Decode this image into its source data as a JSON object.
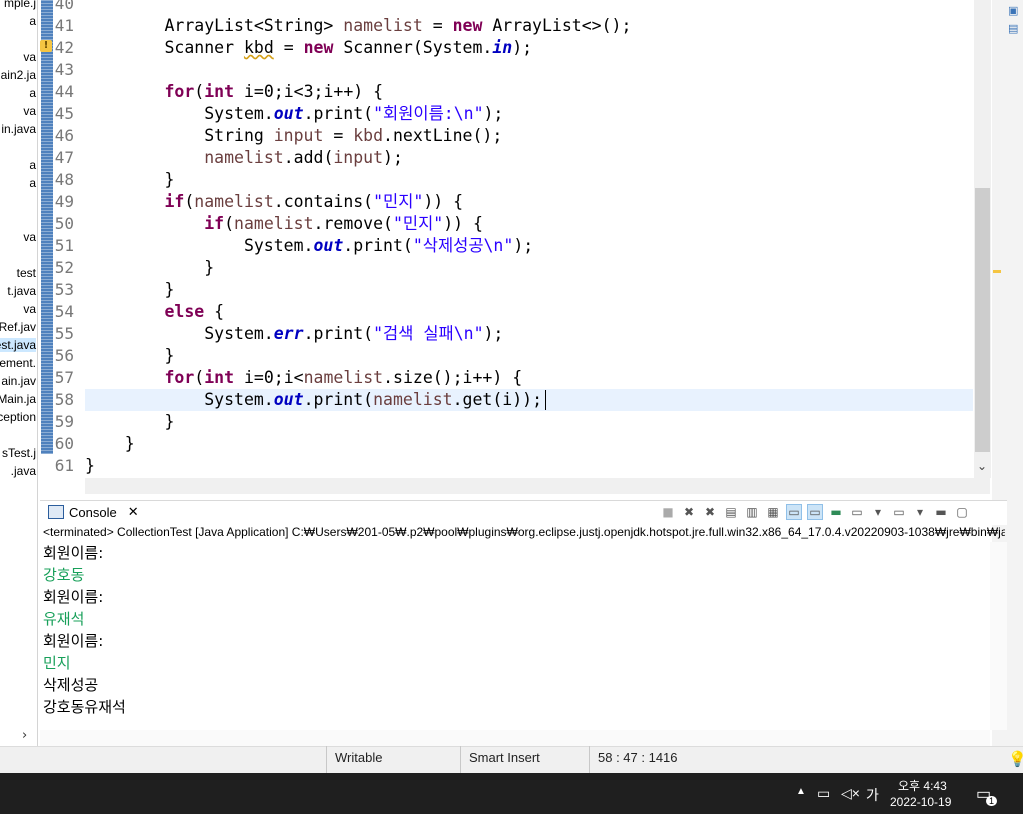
{
  "explorer": {
    "items": [
      "mple.j",
      "a",
      "",
      "va",
      "ain2.ja",
      "a",
      "va",
      "in.java",
      "",
      "a",
      "a",
      "",
      "",
      "va",
      "",
      "test",
      "t.java",
      "va",
      "Ref.jav",
      "est.java",
      "ement.",
      "ain.jav",
      "Main.ja",
      "ception",
      "",
      "sTest.j",
      ".java"
    ]
  },
  "editor": {
    "line_numbers": [
      "40",
      "41",
      "42",
      "43",
      "44",
      "45",
      "46",
      "47",
      "48",
      "49",
      "50",
      "51",
      "52",
      "53",
      "54",
      "55",
      "56",
      "57",
      "58",
      "59",
      "60",
      "61"
    ],
    "lines": [
      [],
      [
        [
          "",
          "        ArrayList<String> "
        ],
        [
          "var",
          "namelist"
        ],
        [
          "",
          " = "
        ],
        [
          "kw",
          "new"
        ],
        [
          "",
          " ArrayList<>();"
        ]
      ],
      [
        [
          "",
          "        Scanner "
        ],
        [
          "warnvar",
          "kbd"
        ],
        [
          "",
          " = "
        ],
        [
          "kw",
          "new"
        ],
        [
          "",
          " Scanner(System."
        ],
        [
          "fld",
          "in"
        ],
        [
          "",
          ");"
        ]
      ],
      [],
      [
        [
          "",
          "        "
        ],
        [
          "kw",
          "for"
        ],
        [
          "",
          "("
        ],
        [
          "kw",
          "int"
        ],
        [
          "",
          " i=0;i<3;i++) {"
        ]
      ],
      [
        [
          "",
          "            System."
        ],
        [
          "fld",
          "out"
        ],
        [
          "",
          ".print("
        ],
        [
          "str",
          "\"회원이름:\\n\""
        ],
        [
          "",
          ");"
        ]
      ],
      [
        [
          "",
          "            String "
        ],
        [
          "var",
          "input"
        ],
        [
          "",
          " = "
        ],
        [
          "var",
          "kbd"
        ],
        [
          "",
          ".nextLine();"
        ]
      ],
      [
        [
          "",
          "            "
        ],
        [
          "var",
          "namelist"
        ],
        [
          "",
          ".add("
        ],
        [
          "var",
          "input"
        ],
        [
          "",
          ");"
        ]
      ],
      [
        [
          "",
          "        }"
        ]
      ],
      [
        [
          "",
          "        "
        ],
        [
          "kw",
          "if"
        ],
        [
          "",
          "("
        ],
        [
          "var",
          "namelist"
        ],
        [
          "",
          ".contains("
        ],
        [
          "str",
          "\"민지\""
        ],
        [
          "",
          ")) {"
        ]
      ],
      [
        [
          "",
          "            "
        ],
        [
          "kw",
          "if"
        ],
        [
          "",
          "("
        ],
        [
          "var",
          "namelist"
        ],
        [
          "",
          ".remove("
        ],
        [
          "str",
          "\"민지\""
        ],
        [
          "",
          ")) {"
        ]
      ],
      [
        [
          "",
          "                System."
        ],
        [
          "fld",
          "out"
        ],
        [
          "",
          ".print("
        ],
        [
          "str",
          "\"삭제성공\\n\""
        ],
        [
          "",
          ");"
        ]
      ],
      [
        [
          "",
          "            }"
        ]
      ],
      [
        [
          "",
          "        }"
        ]
      ],
      [
        [
          "",
          "        "
        ],
        [
          "kw",
          "else"
        ],
        [
          "",
          " {"
        ]
      ],
      [
        [
          "",
          "            System."
        ],
        [
          "fld",
          "err"
        ],
        [
          "",
          ".print("
        ],
        [
          "str",
          "\"검색 실패\\n\""
        ],
        [
          "",
          ");"
        ]
      ],
      [
        [
          "",
          "        }"
        ]
      ],
      [
        [
          "",
          "        "
        ],
        [
          "kw",
          "for"
        ],
        [
          "",
          "("
        ],
        [
          "kw",
          "int"
        ],
        [
          "",
          " i=0;i<"
        ],
        [
          "var",
          "namelist"
        ],
        [
          "",
          ".size();i++) {"
        ]
      ],
      [
        [
          "",
          "            System."
        ],
        [
          "fld",
          "out"
        ],
        [
          "",
          ".print("
        ],
        [
          "var",
          "namelist"
        ],
        [
          "",
          ".get(i));"
        ]
      ],
      [
        [
          "",
          "        }"
        ]
      ],
      [
        [
          "",
          "    }"
        ]
      ],
      [
        [
          "",
          "}"
        ]
      ]
    ]
  },
  "console": {
    "tab_label": "Console",
    "status": "<terminated> CollectionTest [Java Application] C:₩Users₩201-05₩.p2₩pool₩plugins₩org.eclipse.justj.openjdk.hotspot.jre.full.win32.x86_64_17.0.4.v20220903-1038₩jre₩bin₩jav",
    "output": [
      {
        "text": "회원이름:",
        "type": "out"
      },
      {
        "text": "강호동",
        "type": "in"
      },
      {
        "text": "회원이름:",
        "type": "out"
      },
      {
        "text": "유재석",
        "type": "in"
      },
      {
        "text": "회원이름:",
        "type": "out"
      },
      {
        "text": "민지",
        "type": "in"
      },
      {
        "text": "삭제성공",
        "type": "out"
      },
      {
        "text": "강호동유재석",
        "type": "out"
      }
    ]
  },
  "statusbar": {
    "writable": "Writable",
    "insert_mode": "Smart Insert",
    "position": "58 : 47 : 1416"
  },
  "taskbar": {
    "ampm_time": "오후 4:43",
    "date": "2022-10-19",
    "ime": "가",
    "notification_count": "1"
  },
  "colors": {
    "keyword": "#7f0055",
    "string": "#2a00ff",
    "field": "#0000c0",
    "variable": "#6a3e3e",
    "console_input": "#18a05a"
  }
}
